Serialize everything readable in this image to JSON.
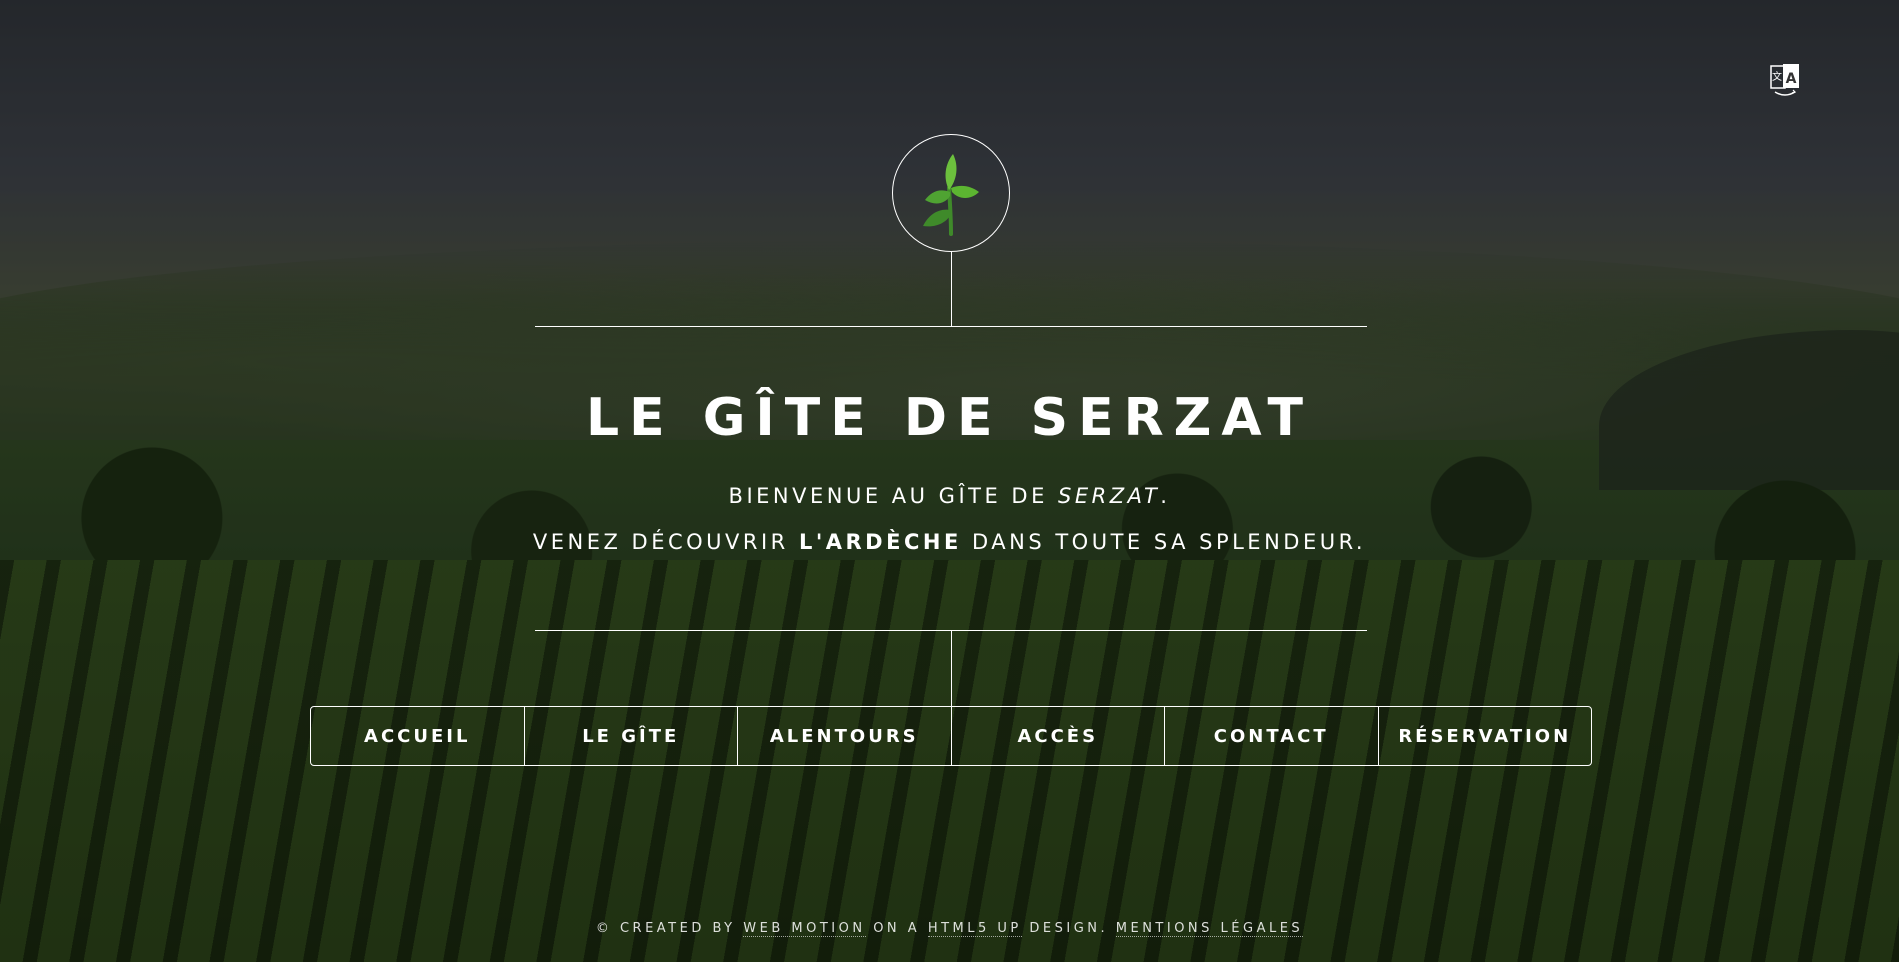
{
  "header": {
    "translate_icon": "translate-icon",
    "logo_icon": "seedling-icon"
  },
  "hero": {
    "title": "Le Gîte de Serzat",
    "line1_prefix": "Bienvenue au gîte de ",
    "line1_emphasis": "Serzat",
    "line1_suffix": ".",
    "line2_prefix": "Venez découvrir ",
    "line2_strong": "l'Ardèche",
    "line2_suffix": " dans toute sa splendeur."
  },
  "nav": {
    "items": [
      {
        "label": "Accueil"
      },
      {
        "label": "Le Gîte"
      },
      {
        "label": "Alentours"
      },
      {
        "label": "Accès"
      },
      {
        "label": "Contact"
      },
      {
        "label": "Réservation"
      }
    ]
  },
  "footer": {
    "prefix": "© Created by ",
    "link1": "Web Motion",
    "middle": " on a ",
    "link2": "HTML5 UP",
    "suffix": " design. ",
    "link3": "Mentions légales"
  },
  "colors": {
    "text": "#ffffff",
    "leaf": "#5cb531"
  }
}
